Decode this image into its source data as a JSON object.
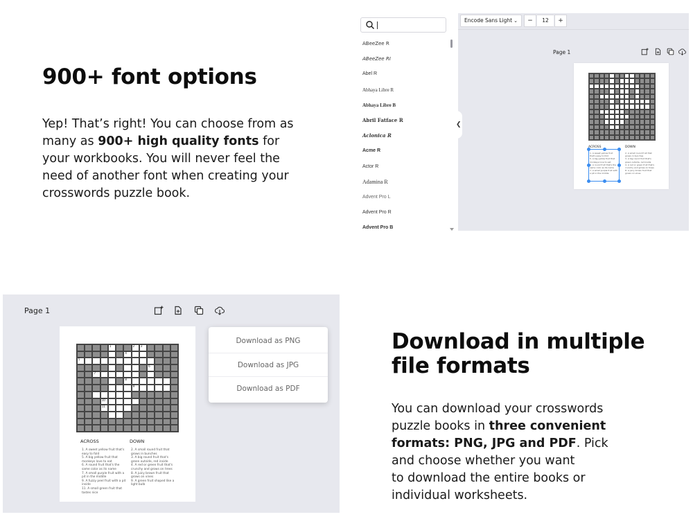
{
  "section_fonts": {
    "title": "900+ font options",
    "body_before": "Yep! That’s right! You can choose from as many as ",
    "body_bold": "900+ high quality fonts",
    "body_after": " for your workbooks. You will never feel the need of another font when creating your crosswords puzzle book."
  },
  "font_panel": {
    "search_value": "",
    "fonts": [
      "ABeeZee R",
      "ABeeZee RI",
      "Abel R",
      "Abhaya Libre R",
      "Abhaya Libre B",
      "Abril Fatface R",
      "Aclonica R",
      "Acme R",
      "Actor R",
      "Adamina R",
      "Advent Pro L",
      "Advent Pro R",
      "Advent Pro B"
    ]
  },
  "editor_top": {
    "font_select": "Encode Sans Light",
    "minus": "−",
    "size": "12",
    "plus": "+",
    "page_label": "Page 1",
    "across_label": "ACROSS",
    "down_label": "DOWN"
  },
  "editor_bottom": {
    "page_label": "Page 1",
    "across_label": "ACROSS",
    "down_label": "DOWN",
    "across_clues": [
      "1. A sweet yellow fruit that's easy to fold",
      "5. A big yellow fruit that monkeys love to eat",
      "6. A round fruit that's the same color as its name",
      "7. A small purple fruit with a pit in the middle",
      "9. A fuzzy peel fruit with a pit inside",
      "11. A small green fruit that tastes nice"
    ],
    "down_clues": [
      "2. A small round fruit that grows in bunches",
      "3. A big round fruit that's green outside, red inside",
      "4. A red or green fruit that's crunchy and grows on trees",
      "8. A juicy brown fruit that grows on vines",
      "9. A green fruit shaped like a light bulb"
    ],
    "menu": [
      "Download as PNG",
      "Download as JPG",
      "Download as PDF"
    ]
  },
  "section_download": {
    "title_line1": "Download in multiple",
    "title_line2": "file formats",
    "l1": "You can download your crosswords",
    "l2_plain": "puzzle books in ",
    "l2_bold": "three convenient",
    "l3_bold": "formats: PNG, JPG and PDF",
    "l3_plain": ". Pick",
    "l4": "and choose whether you want",
    "l5": "to download the entire books or",
    "l6": "individual worksheets."
  },
  "colors": {
    "editor_bg": "#e7e8ee",
    "selection": "#3b8df0",
    "cell_filled": "#8e8e8e"
  }
}
